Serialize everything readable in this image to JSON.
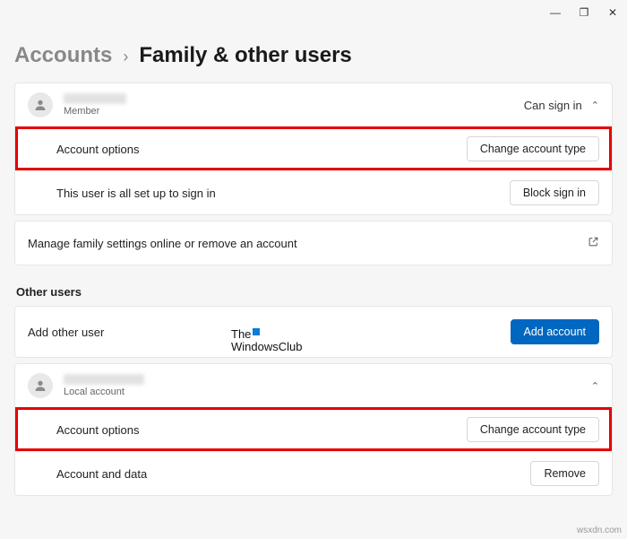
{
  "window": {
    "minimize": "—",
    "restore": "❐",
    "close": "✕"
  },
  "breadcrumb": {
    "parent": "Accounts",
    "sep": "›",
    "current": "Family & other users"
  },
  "family_user": {
    "role": "Member",
    "status": "Can sign in",
    "account_options_label": "Account options",
    "change_type_btn": "Change account type",
    "signin_msg": "This user is all set up to sign in",
    "block_btn": "Block sign in"
  },
  "manage_link": {
    "label": "Manage family settings online or remove an account",
    "icon": "↗"
  },
  "other_users_title": "Other users",
  "add_user": {
    "label": "Add other user",
    "button": "Add account"
  },
  "local_user": {
    "role": "Local account",
    "account_options_label": "Account options",
    "change_type_btn": "Change account type",
    "data_label": "Account and data",
    "remove_btn": "Remove"
  },
  "watermark": {
    "line1": "The",
    "line2": "WindowsClub"
  },
  "footer": "wsxdn.com"
}
